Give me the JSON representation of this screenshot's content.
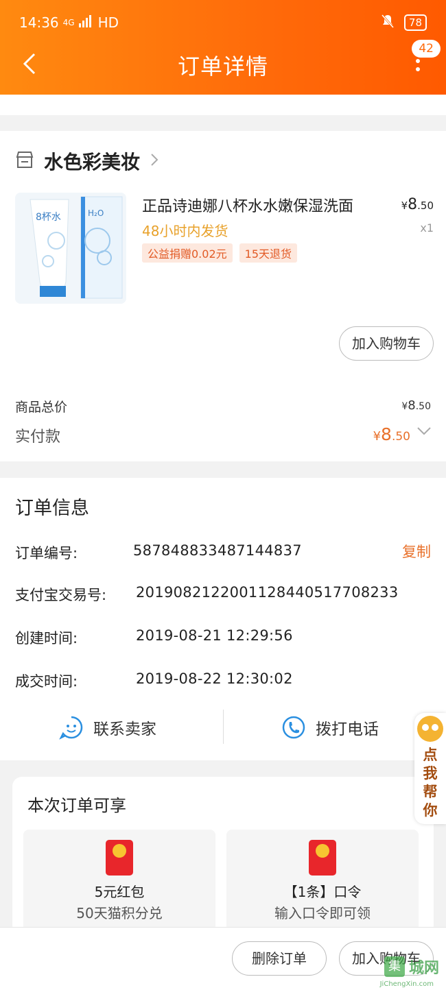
{
  "status": {
    "time": "14:36",
    "network": "4G",
    "signal": "HD",
    "battery": "78"
  },
  "header": {
    "title": "订单详情",
    "badge": "42"
  },
  "shop": {
    "name": "水色彩美妆",
    "product": {
      "title": "正品诗迪娜八杯水水嫩保湿洗面",
      "shipping": "48小时内发货",
      "tags": [
        "公益捐赠0.02元",
        "15天退货"
      ],
      "price_main": "8",
      "price_dec": ".50",
      "quantity": "x1",
      "image_text": "8杯水",
      "add_cart": "加入购物车"
    },
    "total_label": "商品总价",
    "total_main": "8",
    "total_dec": ".50",
    "paid_label": "实付款",
    "paid_main": "8",
    "paid_dec": ".50",
    "currency": "¥"
  },
  "order_info": {
    "title": "订单信息",
    "order_no_label": "订单编号:",
    "order_no": "587848833487144837",
    "copy": "复制",
    "alipay_label": "支付宝交易号:",
    "alipay_no": "2019082122001128440517708233",
    "created_label": "创建时间:",
    "created": "2019-08-21 12:29:56",
    "deal_label": "成交时间:",
    "deal": "2019-08-22 12:30:02",
    "contact_seller": "联系卖家",
    "call": "拨打电话"
  },
  "benefits": {
    "title": "本次订单可享",
    "items": [
      {
        "name": "5元红包",
        "desc": "50天猫积分兑"
      },
      {
        "name": "【1条】口令",
        "desc": "输入口令即可领"
      }
    ]
  },
  "help": {
    "text": "点我帮你"
  },
  "bottom": {
    "delete": "删除订单",
    "add_cart": "加入购物车"
  },
  "watermark": {
    "logo": "集",
    "text": "城网",
    "url": "JiChengXin.com"
  },
  "colors": {
    "header_start": "#ff8a10",
    "header_end": "#ff5a00",
    "accent": "#e8702a",
    "price": "#e8702a"
  }
}
